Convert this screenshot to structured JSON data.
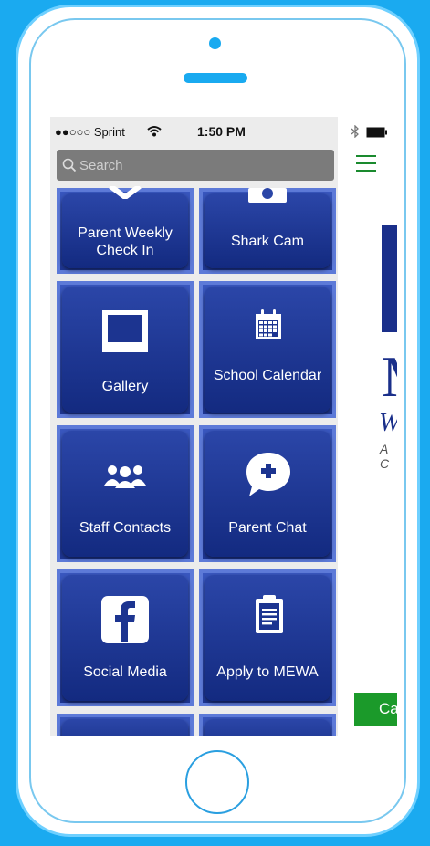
{
  "status_bar": {
    "carrier": "●●○○○ Sprint",
    "time": "1:50 PM"
  },
  "search": {
    "placeholder": "Search"
  },
  "tiles": [
    {
      "label": "Parent Weekly Check In",
      "icon": "check-icon"
    },
    {
      "label": "Shark Cam",
      "icon": "camera-icon"
    },
    {
      "label": "Gallery",
      "icon": "photo-frame-icon"
    },
    {
      "label": "School Calendar",
      "icon": "calendar-icon"
    },
    {
      "label": "Staff Contacts",
      "icon": "people-icon"
    },
    {
      "label": "Parent Chat",
      "icon": "chat-bubble-plus-icon"
    },
    {
      "label": "Social Media",
      "icon": "facebook-icon"
    },
    {
      "label": "Apply to MEWA",
      "icon": "clipboard-icon"
    }
  ],
  "right_panel": {
    "button_label": "Ca",
    "logo_letters": "M",
    "logo_sub": "W",
    "logo_small": "A C"
  },
  "colors": {
    "background": "#1aaaf0",
    "tile_blue": "#1c3490",
    "accent_green": "#1a8a2e"
  }
}
